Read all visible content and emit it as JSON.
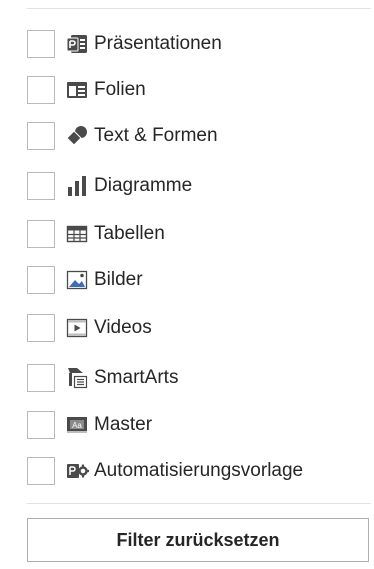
{
  "filters": {
    "items": [
      {
        "label": "Präsentationen",
        "icon": "presentation-file-icon",
        "checked": false
      },
      {
        "label": "Folien",
        "icon": "slide-icon",
        "checked": false
      },
      {
        "label": "Text & Formen",
        "icon": "shapes-icon",
        "checked": false
      },
      {
        "label": "Diagramme",
        "icon": "bar-chart-icon",
        "checked": false
      },
      {
        "label": "Tabellen",
        "icon": "table-icon",
        "checked": false
      },
      {
        "label": "Bilder",
        "icon": "picture-icon",
        "checked": false
      },
      {
        "label": "Videos",
        "icon": "video-icon",
        "checked": false
      },
      {
        "label": "SmartArts",
        "icon": "smartart-icon",
        "checked": false
      },
      {
        "label": "Master",
        "icon": "master-icon",
        "checked": false
      },
      {
        "label": "Automatisierungsvorlage",
        "icon": "automation-template-icon",
        "checked": false
      }
    ],
    "reset_label": "Filter zurücksetzen"
  },
  "colors": {
    "text": "#262626",
    "icon_dark": "#4a4a4a",
    "icon_blue": "#3e6fb5",
    "checkbox_border": "#b9b9b9",
    "divider": "#e3e3e3"
  }
}
